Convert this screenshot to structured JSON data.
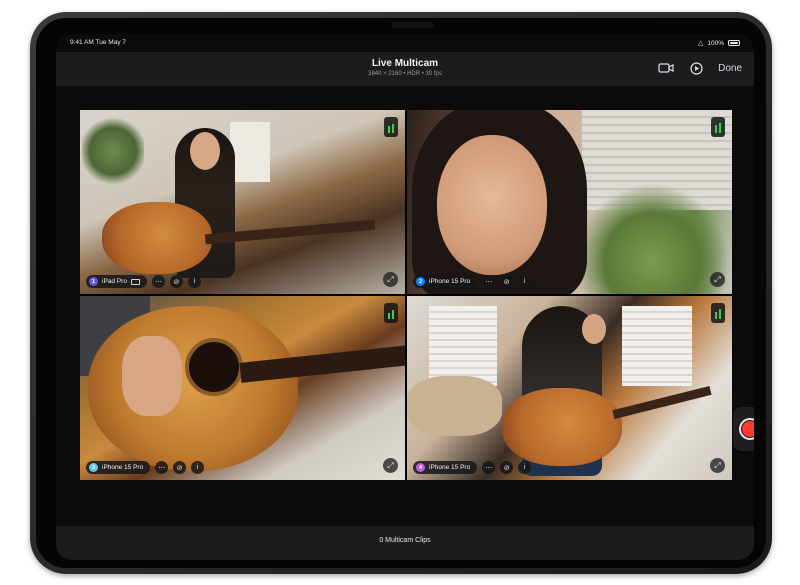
{
  "status": {
    "time": "9:41 AM  Tue May 7",
    "battery": "100%"
  },
  "header": {
    "title": "Live Multicam",
    "subtitle": "3840 × 2160 • HDR • 30 fps",
    "done_label": "Done"
  },
  "cameras": [
    {
      "number": "1",
      "name": "iPad Pro",
      "color": "#5e5ce6"
    },
    {
      "number": "2",
      "name": "iPhone 15 Pro",
      "color": "#0a84ff"
    },
    {
      "number": "3",
      "name": "iPhone 15 Pro",
      "color": "#5ac8fa"
    },
    {
      "number": "4",
      "name": "iPhone 15 Pro",
      "color": "#bf5af2"
    }
  ],
  "footer": {
    "clips_label": "0 Multicam Clips"
  },
  "colors": {
    "record": "#ff3b30",
    "audio_level": "#34d058",
    "bar_bg": "#1c1c1e"
  }
}
